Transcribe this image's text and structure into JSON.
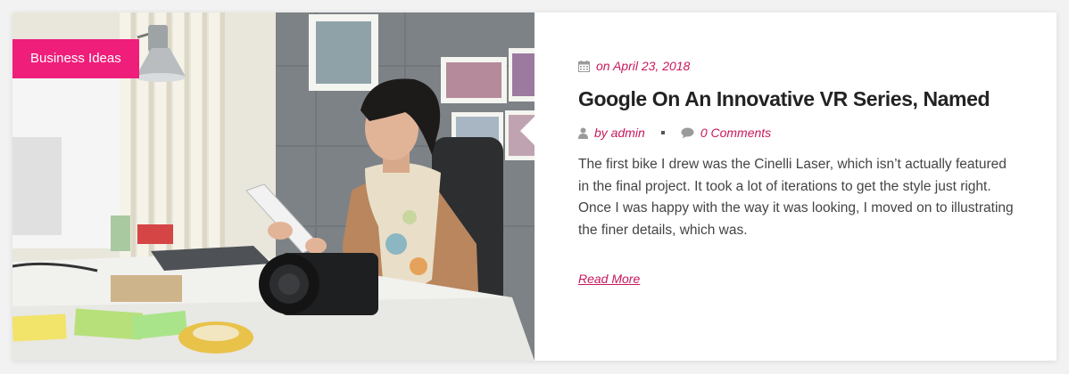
{
  "colors": {
    "accent": "#c8185e",
    "badge_bg": "#ee1e7a",
    "icon_gray": "#9a9a9a"
  },
  "post": {
    "category": "Business Ideas",
    "date": "on April 23, 2018",
    "title": "Google On An Innovative VR Series, Named",
    "author": "by admin",
    "comments": "0 Comments",
    "excerpt": "The first bike I drew was the Cinelli Laser, which isn’t actually featured in the final project. It took a lot of iterations to get the style just right. Once I was happy with the way it was looking, I moved on to illustrating the finer details, which was.",
    "read_more": "Read More"
  },
  "icons": {
    "date": "calendar-icon",
    "author": "user-icon",
    "comments": "comment-icon"
  }
}
